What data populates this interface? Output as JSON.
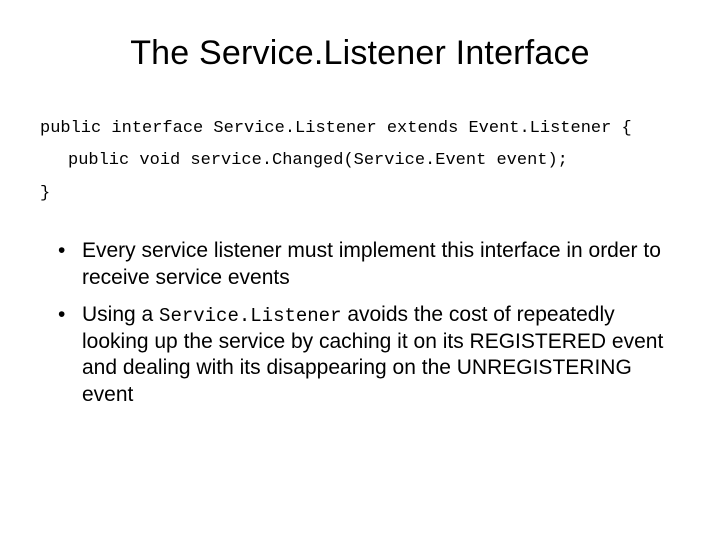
{
  "title": "The Service.Listener Interface",
  "code": {
    "line1": "public interface Service.Listener extends Event.Listener {",
    "line2": "public void service.Changed(Service.Event event);",
    "line3": "}"
  },
  "bullets": [
    {
      "text": "Every service listener must implement this interface in order to receive service events"
    },
    {
      "prefix": "Using a ",
      "mono": "Service.Listener",
      "suffix": " avoids the cost of repeatedly looking up the service by caching it on its REGISTERED event and dealing with its disappearing on the UNREGISTERING event"
    }
  ]
}
